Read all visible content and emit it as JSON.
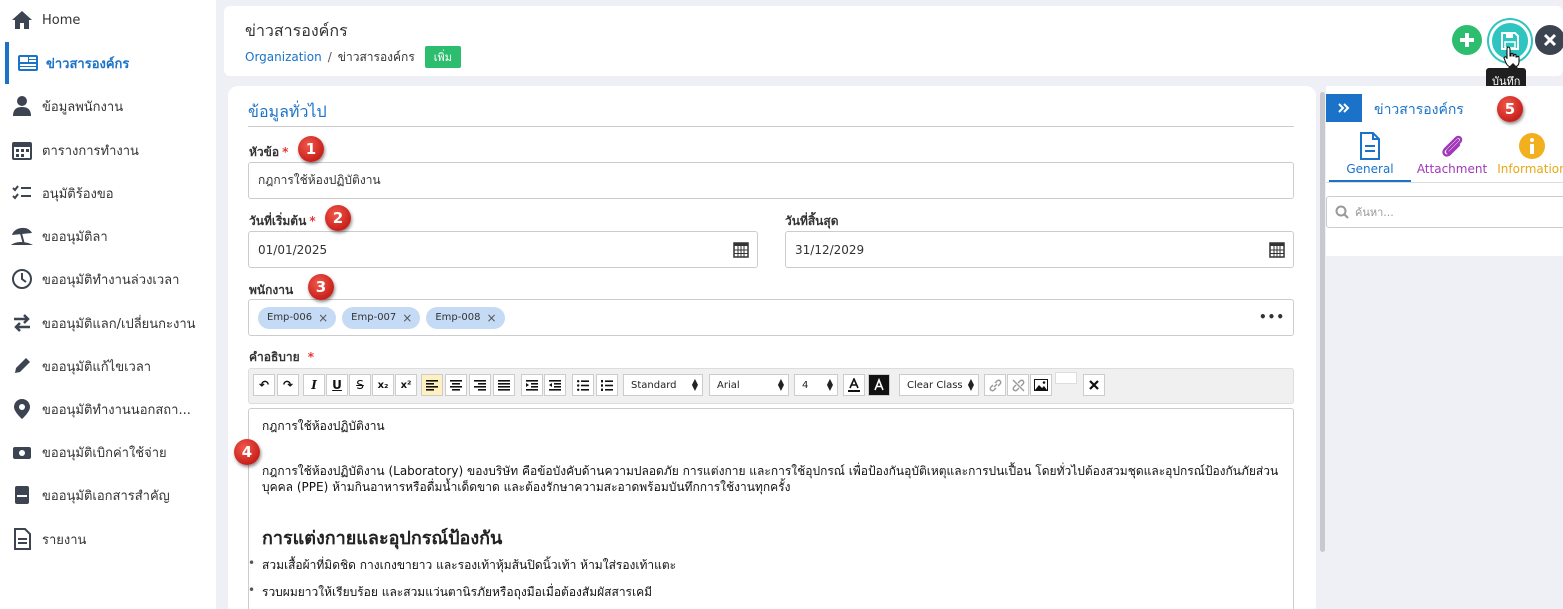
{
  "sidebar": {
    "items": [
      {
        "label": "Home",
        "icon": "home-icon"
      },
      {
        "label": "ข่าวสารองค์กร",
        "icon": "news-icon"
      },
      {
        "label": "ข้อมูลพนักงาน",
        "icon": "person-icon"
      },
      {
        "label": "ตารางการทำงาน",
        "icon": "calendar-icon"
      },
      {
        "label": "อนุมัติร้องขอ",
        "icon": "checklist-icon"
      },
      {
        "label": "ขออนุมัติลา",
        "icon": "beach-umbrella-icon"
      },
      {
        "label": "ขออนุมัติทำงานล่วงเวลา",
        "icon": "clock-icon"
      },
      {
        "label": "ขออนุมัติแลก/เปลี่ยนกะงาน",
        "icon": "swap-arrows-icon"
      },
      {
        "label": "ขออนุมัติแก้ไขเวลา",
        "icon": "pencil-icon"
      },
      {
        "label": "ขออนุมัติทำงานนอกสถา...",
        "icon": "location-pin-icon"
      },
      {
        "label": "ขออนุมัติเบิกค่าใช้จ่าย",
        "icon": "money-icon"
      },
      {
        "label": "ขออนุมัติเอกสารสำคัญ",
        "icon": "document-stack-icon"
      },
      {
        "label": "รายงาน",
        "icon": "report-icon"
      }
    ]
  },
  "header": {
    "title": "ข่าวสารองค์กร",
    "breadcrumb": {
      "link": "Organization",
      "separator": "/",
      "current": "ข่าวสารองค์กร",
      "badge": "เพิ่ม"
    },
    "save_tooltip": "บันทึก"
  },
  "form": {
    "section_title": "ข้อมูลทั่วไป",
    "subject": {
      "label": "หัวข้อ",
      "required": "*",
      "value": "กฎการใช้ห้องปฏิบัติงาน"
    },
    "start_date": {
      "label": "วันที่เริ่มต้น",
      "required": "*",
      "value": "01/01/2025"
    },
    "end_date": {
      "label": "วันที่สิ้นสุด",
      "value": "31/12/2029"
    },
    "employees": {
      "label": "พนักงาน",
      "chips": [
        "Emp-006",
        "Emp-007",
        "Emp-008"
      ]
    },
    "description": {
      "label": "คำอธิบาย",
      "required": "*"
    }
  },
  "editor": {
    "toolbar": {
      "undo": "↶",
      "redo": "↷",
      "italic": "I",
      "underline": "U",
      "strike": "S",
      "subscript": "x₂",
      "superscript": "x²",
      "style_select": "Standard",
      "font_select": "Arial",
      "size_select": "4",
      "clear_class": "Clear Class"
    },
    "content": {
      "line1": "กฎการใช้ห้องปฏิบัติงาน",
      "para": "กฎการใช้ห้องปฏิบัติงาน (Laboratory) ของบริษัท คือข้อบังคับด้านความปลอดภัย การแต่งกาย และการใช้อุปกรณ์ เพื่อป้องกันอุบัติเหตุและการปนเปื้อน โดยทั่วไปต้องสวมชุดและอุปกรณ์ป้องกันภัยส่วนบุคคล (PPE) ห้ามกินอาหารหรือดื่มน้ำเด็ดขาด และต้องรักษาความสะอาดพร้อมบันทึกการใช้งานทุกครั้ง",
      "heading": "การแต่งกายและอุปกรณ์ป้องกัน",
      "bullets": [
        "สวมเสื้อผ้าที่มิดชิด กางเกงขายาว และรองเท้าหุ้มส้นปิดนิ้วเท้า ห้ามใส่รองเท้าแตะ",
        "รวบผมยาวให้เรียบร้อย และสวมแว่นตานิรภัยหรือถุงมือเมื่อต้องสัมผัสสารเคมี"
      ]
    }
  },
  "markers": [
    "1",
    "2",
    "3",
    "4",
    "5"
  ],
  "right_panel": {
    "title": "ข่าวสารองค์กร",
    "tabs": [
      {
        "label": "General",
        "color": "#1a73c8"
      },
      {
        "label": "Attachment",
        "color": "#a038b8"
      },
      {
        "label": "Information",
        "color": "#e6a817"
      }
    ],
    "search_placeholder": "ค้นหา..."
  },
  "colors": {
    "accent": "#1a73c8",
    "success": "#2dbd6e",
    "save": "#2ec4c0",
    "marker": "#d9261e"
  }
}
